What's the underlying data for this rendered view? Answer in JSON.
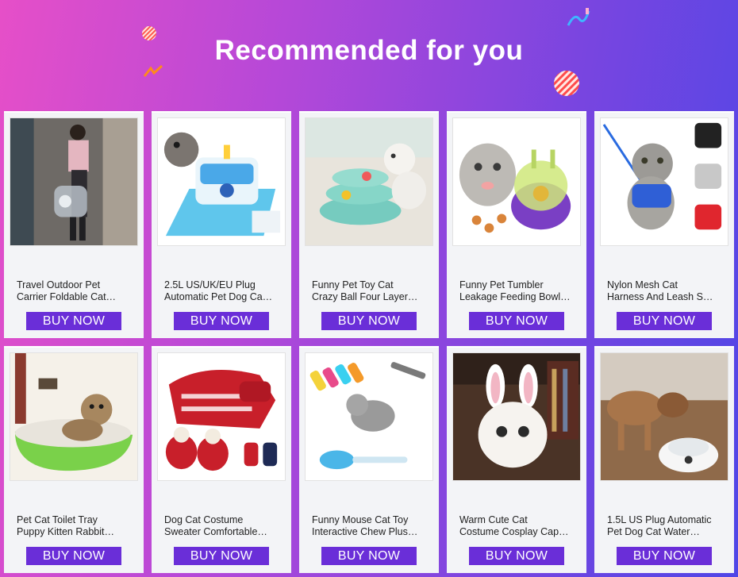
{
  "header": {
    "title": "Recommended for you"
  },
  "colors": {
    "buy_button": "#6a2ed8",
    "card_bg": "#f3f4f7"
  },
  "products": [
    {
      "line1": "Travel Outdoor Pet",
      "line2": "Carrier Foldable Cat…",
      "button": "BUY NOW",
      "image": "pet-carrier-bag-photo"
    },
    {
      "line1": "2.5L US/UK/EU Plug",
      "line2": "Automatic Pet Dog Ca…",
      "button": "BUY NOW",
      "image": "pet-water-fountain-photo"
    },
    {
      "line1": "Funny Pet Toy Cat",
      "line2": "Crazy Ball Four Layer…",
      "button": "BUY NOW",
      "image": "cat-ball-track-toy-photo"
    },
    {
      "line1": "Funny Pet Tumbler",
      "line2": "Leakage Feeding Bowl…",
      "button": "BUY NOW",
      "image": "treat-tumbler-toy-photo"
    },
    {
      "line1": "Nylon Mesh Cat",
      "line2": "Harness And Leash S…",
      "button": "BUY NOW",
      "image": "cat-harness-photo"
    },
    {
      "line1": "Pet Cat Toilet Tray",
      "line2": "Puppy Kitten Rabbit…",
      "button": "BUY NOW",
      "image": "litter-tray-photo"
    },
    {
      "line1": "Dog Cat Costume",
      "line2": "Sweater Comfortable…",
      "button": "BUY NOW",
      "image": "pet-sweater-photo"
    },
    {
      "line1": "Funny Mouse Cat Toy",
      "line2": "Interactive Chew Plus…",
      "button": "BUY NOW",
      "image": "mouse-toy-photo"
    },
    {
      "line1": "Warm Cute Cat",
      "line2": "Costume Cosplay Cap…",
      "button": "BUY NOW",
      "image": "bunny-ear-cap-photo"
    },
    {
      "line1": "1.5L US Plug Automatic",
      "line2": "Pet Dog Cat Water…",
      "button": "BUY NOW",
      "image": "dog-water-dispenser-photo"
    }
  ]
}
